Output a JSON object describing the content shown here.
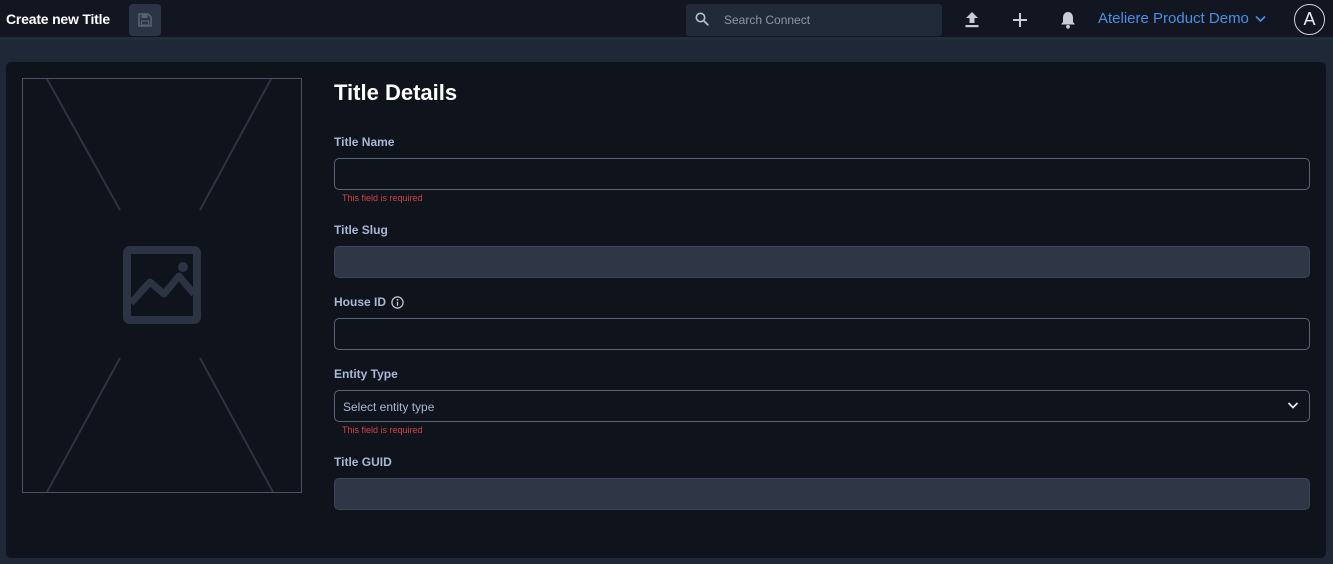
{
  "header": {
    "title": "Create new Title",
    "search_placeholder": "Search Connect",
    "workspace": "Ateliere Product Demo",
    "avatar_initial": "A",
    "icons": [
      "save-icon",
      "search-icon",
      "upload-icon",
      "plus-icon",
      "bell-icon",
      "chevron-down-icon"
    ]
  },
  "form": {
    "section_title": "Title Details",
    "title_name": {
      "label": "Title Name",
      "value": "",
      "error": "This field is required"
    },
    "title_slug": {
      "label": "Title Slug",
      "value": ""
    },
    "house_id": {
      "label": "House ID",
      "value": ""
    },
    "entity_type": {
      "label": "Entity Type",
      "placeholder": "Select entity type",
      "error": "This field is required"
    },
    "title_guid": {
      "label": "Title GUID",
      "value": ""
    }
  },
  "colors": {
    "background": "#1e2836",
    "topbar": "#111620",
    "panel": "#0f131b",
    "accent": "#4d8fe6",
    "error": "#d24545",
    "label": "#a9b8d6"
  }
}
